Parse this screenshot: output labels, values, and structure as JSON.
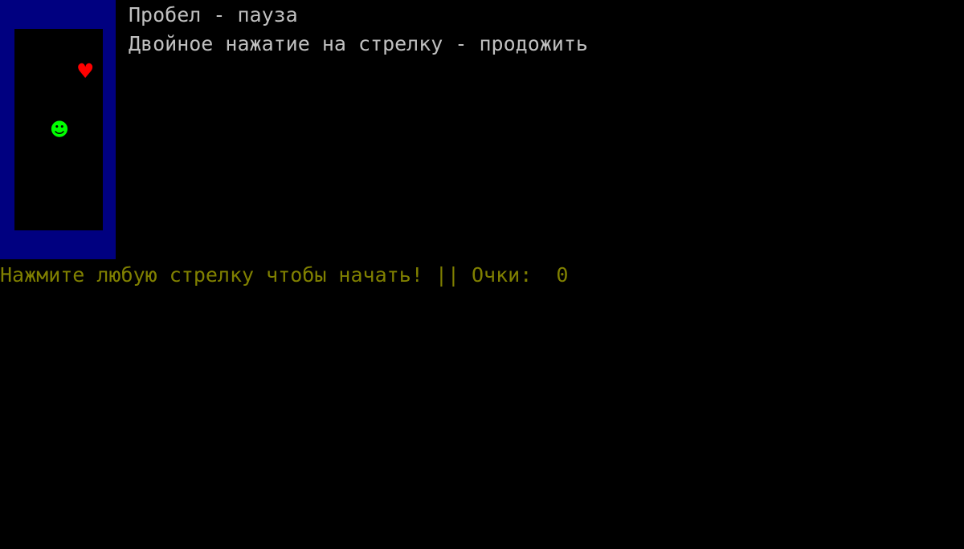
{
  "help": {
    "pause": "Пробел - пауза",
    "resume": "Двойное нажатие на стрелку - продожить"
  },
  "status": {
    "text": "Нажмите любую стрелку чтобы начать! || Очки:  0",
    "score": 0
  },
  "game": {
    "food_glyph": "♥",
    "player_glyph": "☻"
  },
  "colors": {
    "background": "#000000",
    "border": "#000080",
    "help_text": "#c0c0c0",
    "status_text": "#808000",
    "food": "#ff0000",
    "player": "#00ff00"
  }
}
